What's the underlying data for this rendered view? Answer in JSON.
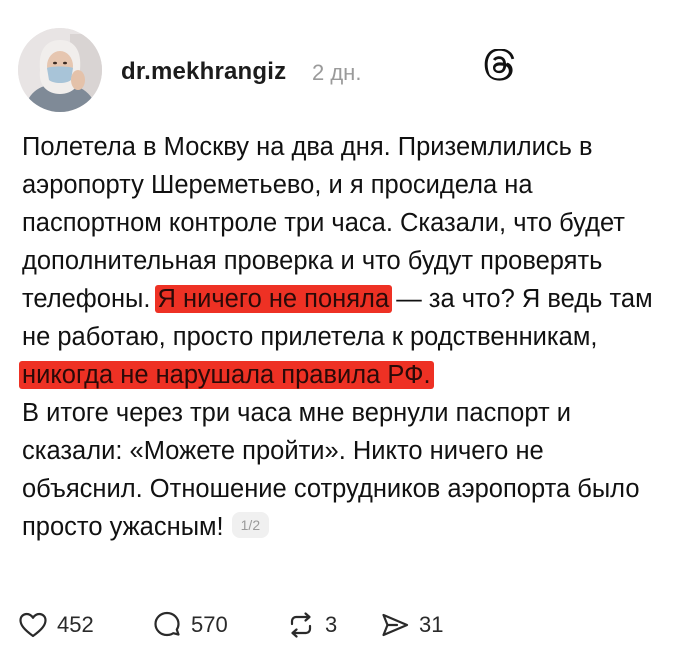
{
  "post": {
    "username": "dr.mekhrangiz",
    "timestamp": "2 дн.",
    "text_p1_a": "Полетела в Москву на два дня. Приземлились в аэропорту Шереметьево, и я просидела на паспортном контроле три часа. Сказали, что будет дополнительная проверка и что будут проверять телефоны. ",
    "text_p1_hl1": "Я ничего не поняла",
    "text_p1_b": " — за что? Я ведь там не работаю, просто прилетела к родственникам, ",
    "text_p1_hl2": "никогда не нарушала правила РФ.",
    "text_p2": "В итоге через три часа мне вернули паспорт и сказали: «Можете пройти». Никто ничего не объяснил. Отношение сотрудников аэропорта было просто ужасным!",
    "page_indicator": "1/2",
    "highlight_color": "#ee3124"
  },
  "actions": {
    "likes": "452",
    "replies": "570",
    "reposts": "3",
    "shares": "31"
  },
  "icons": {
    "app": "threads-icon",
    "like": "heart-icon",
    "reply": "comment-icon",
    "repost": "repost-icon",
    "share": "send-icon"
  }
}
